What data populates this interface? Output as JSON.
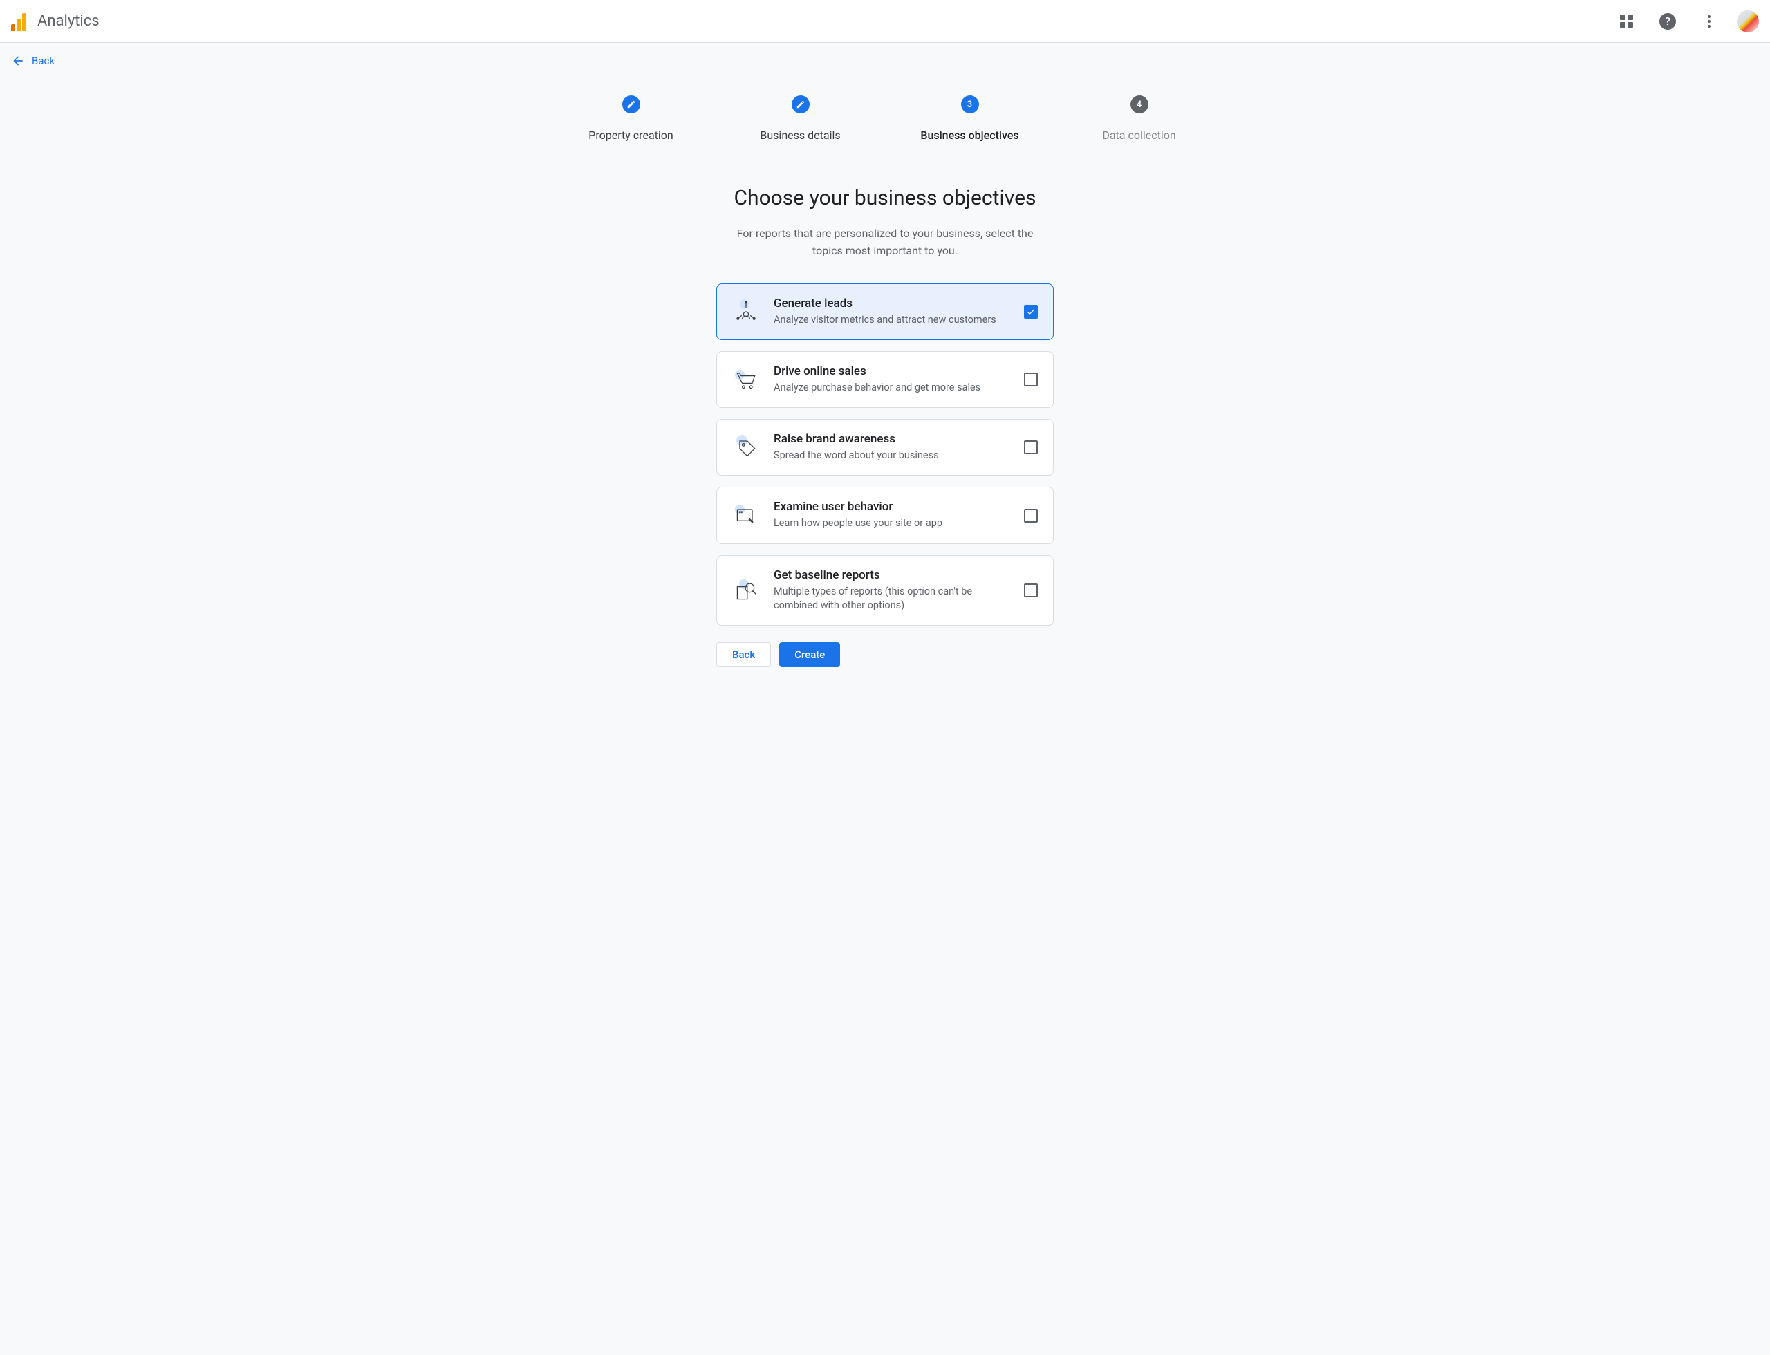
{
  "header": {
    "product_name": "Analytics"
  },
  "backbar": {
    "back_label": "Back"
  },
  "stepper": {
    "steps": [
      {
        "label": "Property creation",
        "state": "done"
      },
      {
        "label": "Business details",
        "state": "done"
      },
      {
        "label": "Business objectives",
        "state": "active",
        "number": "3"
      },
      {
        "label": "Data collection",
        "state": "pending",
        "number": "4"
      }
    ]
  },
  "page": {
    "title": "Choose your business objectives",
    "subtitle": "For reports that are personalized to your business, select the topics most important to you."
  },
  "options": [
    {
      "id": "generate-leads",
      "title": "Generate leads",
      "desc": "Analyze visitor metrics and attract new customers",
      "checked": true,
      "icon": "leads-icon"
    },
    {
      "id": "drive-online-sales",
      "title": "Drive online sales",
      "desc": "Analyze purchase behavior and get more sales",
      "checked": false,
      "icon": "cart-icon"
    },
    {
      "id": "raise-brand-awareness",
      "title": "Raise brand awareness",
      "desc": "Spread the word about your business",
      "checked": false,
      "icon": "tag-icon"
    },
    {
      "id": "examine-user-behavior",
      "title": "Examine user behavior",
      "desc": "Learn how people use your site or app",
      "checked": false,
      "icon": "screen-icon"
    },
    {
      "id": "get-baseline-reports",
      "title": "Get baseline reports",
      "desc": "Multiple types of reports (this option can't be combined with other options)",
      "checked": false,
      "icon": "reports-icon"
    }
  ],
  "buttons": {
    "back": "Back",
    "create": "Create"
  }
}
